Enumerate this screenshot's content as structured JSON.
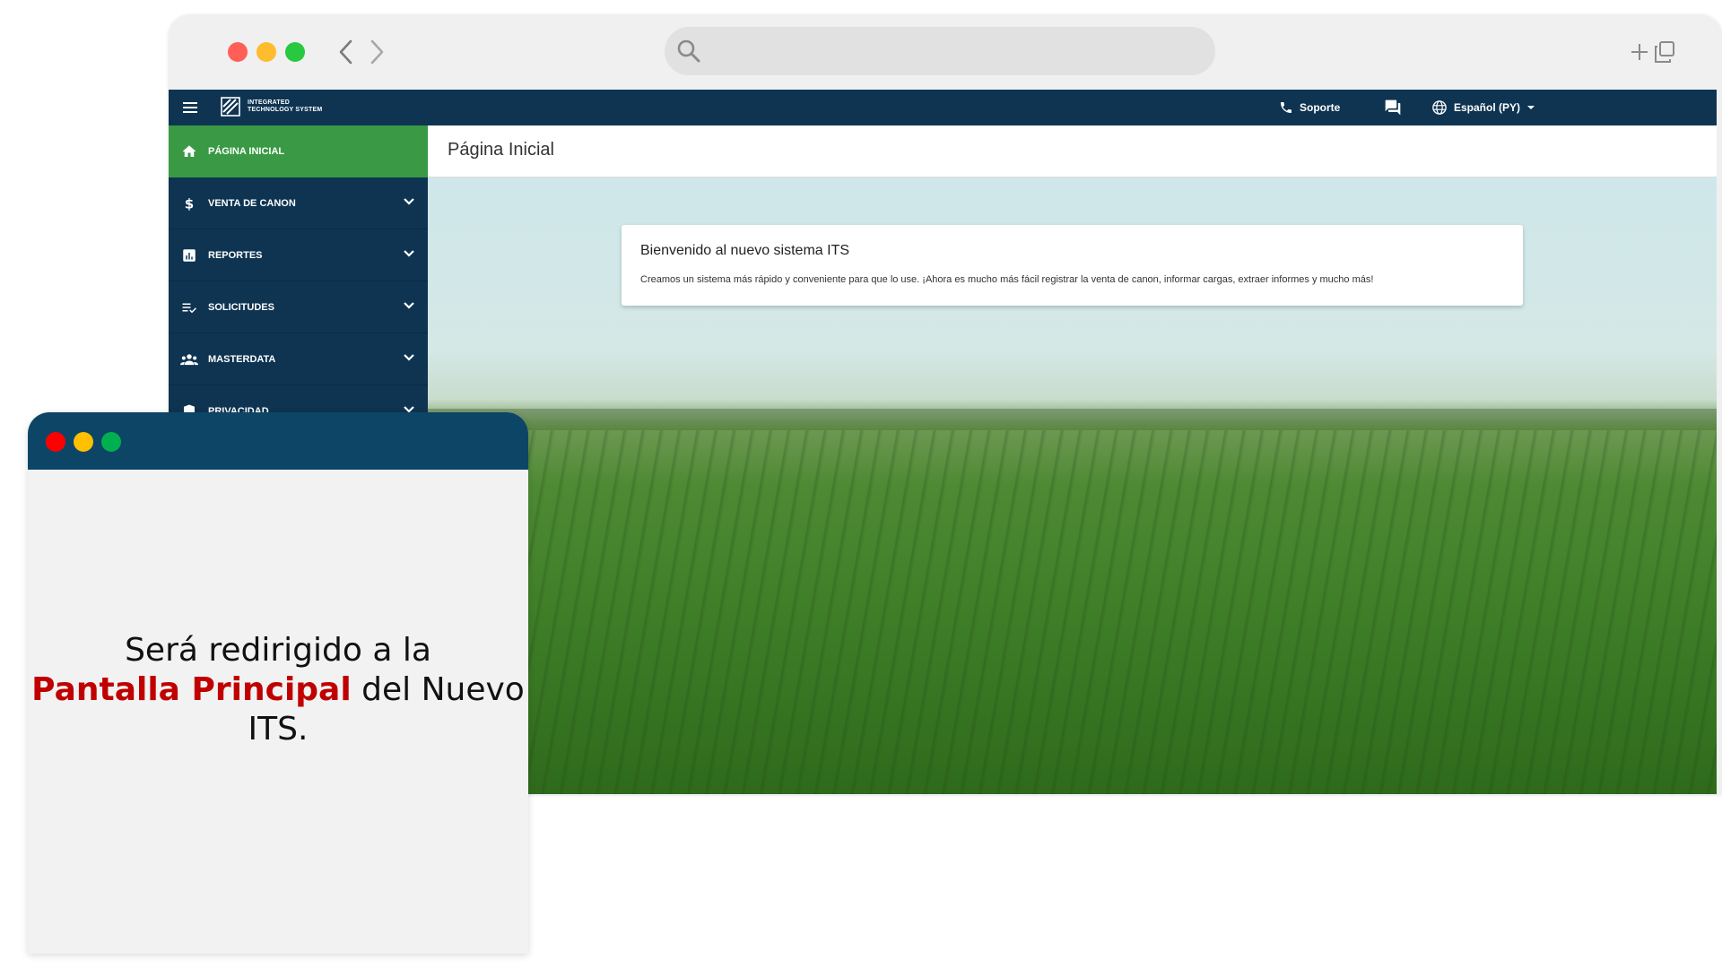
{
  "browser": {
    "dot_colors": [
      "#ff5f57",
      "#febc2e",
      "#28c840"
    ],
    "icons": [
      "chevron-left-icon",
      "chevron-right-icon",
      "search-icon",
      "plus-icon",
      "copy-window-icon"
    ]
  },
  "app": {
    "logo": {
      "text": "INTEGRATED\nTECHNOLOGY SYSTEM"
    },
    "topbar": {
      "support_label": "Soporte",
      "language_label": "Español (PY)",
      "icons": [
        "menu-icon",
        "phone-icon",
        "chat-icon",
        "globe-icon",
        "dropdown-caret-icon"
      ]
    },
    "sidebar": {
      "items": [
        {
          "label": "PÁGINA INICIAL",
          "icon": "home-icon",
          "active": true,
          "expandable": false
        },
        {
          "label": "VENTA DE CANON",
          "icon": "dollar-icon",
          "active": false,
          "expandable": true
        },
        {
          "label": "REPORTES",
          "icon": "bar-chart-icon",
          "active": false,
          "expandable": true
        },
        {
          "label": "SOLICITUDES",
          "icon": "checklist-icon",
          "active": false,
          "expandable": true
        },
        {
          "label": "MASTERDATA",
          "icon": "group-icon",
          "active": false,
          "expandable": true
        },
        {
          "label": "PRIVACIDAD",
          "icon": "shield-icon",
          "active": false,
          "expandable": true
        }
      ],
      "colors": {
        "background": "#0e3452",
        "active": "#3a9944"
      }
    },
    "content": {
      "page_title": "Página Inicial",
      "welcome": {
        "title": "Bienvenido al nuevo sistema ITS",
        "text": "Creamos un sistema más rápido y conveniente para que lo use. ¡Ahora es mucho más fácil registrar la venta de canon, informar cargas, extraer informes y mucho más!"
      }
    }
  },
  "overlay": {
    "titlebar_color": "#0d4566",
    "dot_colors": [
      "#ff0000",
      "#ffc000",
      "#00b050"
    ],
    "message": {
      "before": "Será redirigido a la",
      "highlight": "Pantalla Principal",
      "after": "del Nuevo ITS.",
      "highlight_color": "#c00000"
    }
  }
}
